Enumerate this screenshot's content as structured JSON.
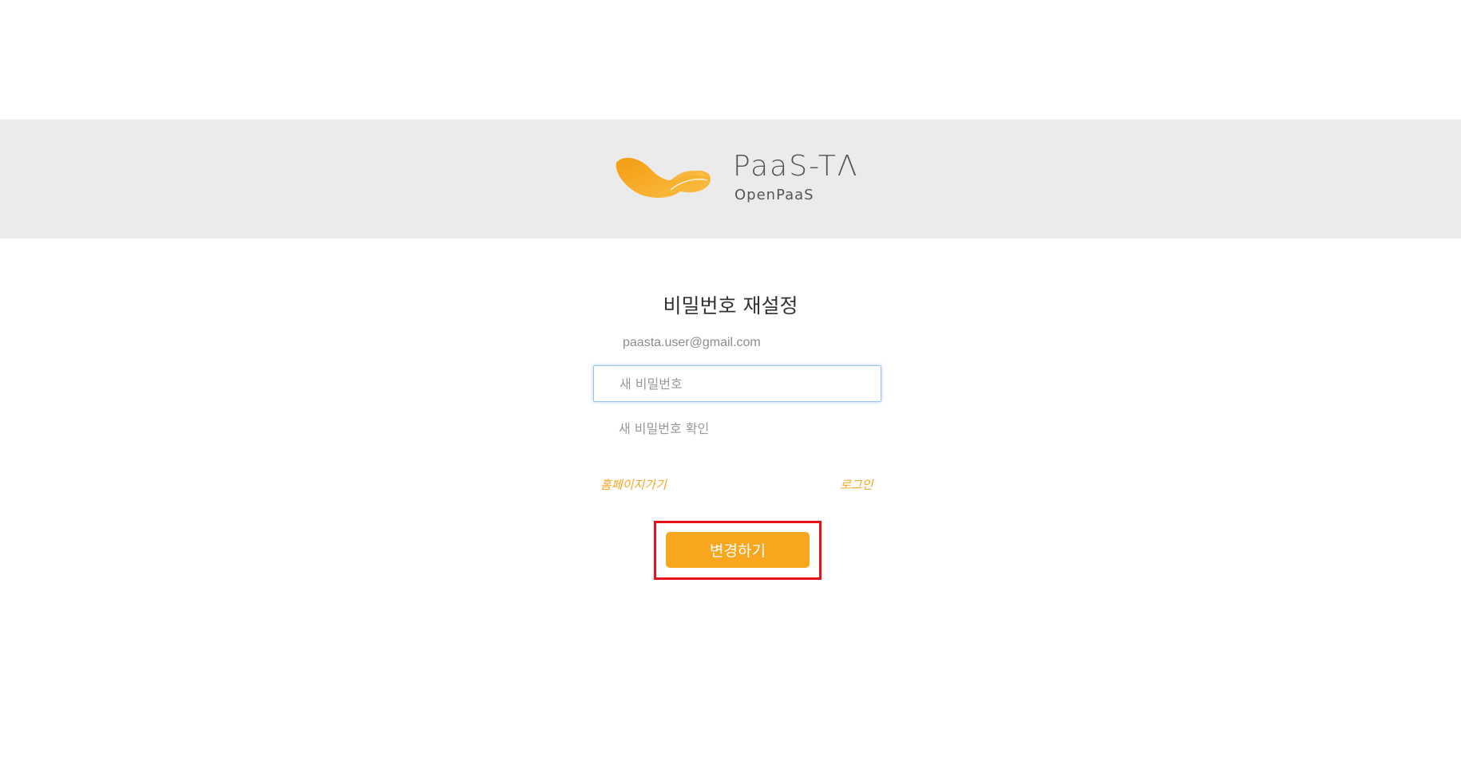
{
  "brand": {
    "title": "PaaS-TΛ",
    "subtitle": "OpenPaaS",
    "logo_icon": "paas-ta-swoosh-icon",
    "accent_color": "#f9a61f"
  },
  "form": {
    "title": "비밀번호 재설정",
    "email": "paasta.user@gmail.com",
    "new_password_placeholder": "새 비밀번호",
    "confirm_password_placeholder": "새 비밀번호 확인",
    "submit_label": "변경하기"
  },
  "links": {
    "home": "홈페이지가기",
    "login": "로그인"
  },
  "colors": {
    "header_band": "#ebebeb",
    "link": "#f5a623",
    "highlight": "#e8141c"
  }
}
